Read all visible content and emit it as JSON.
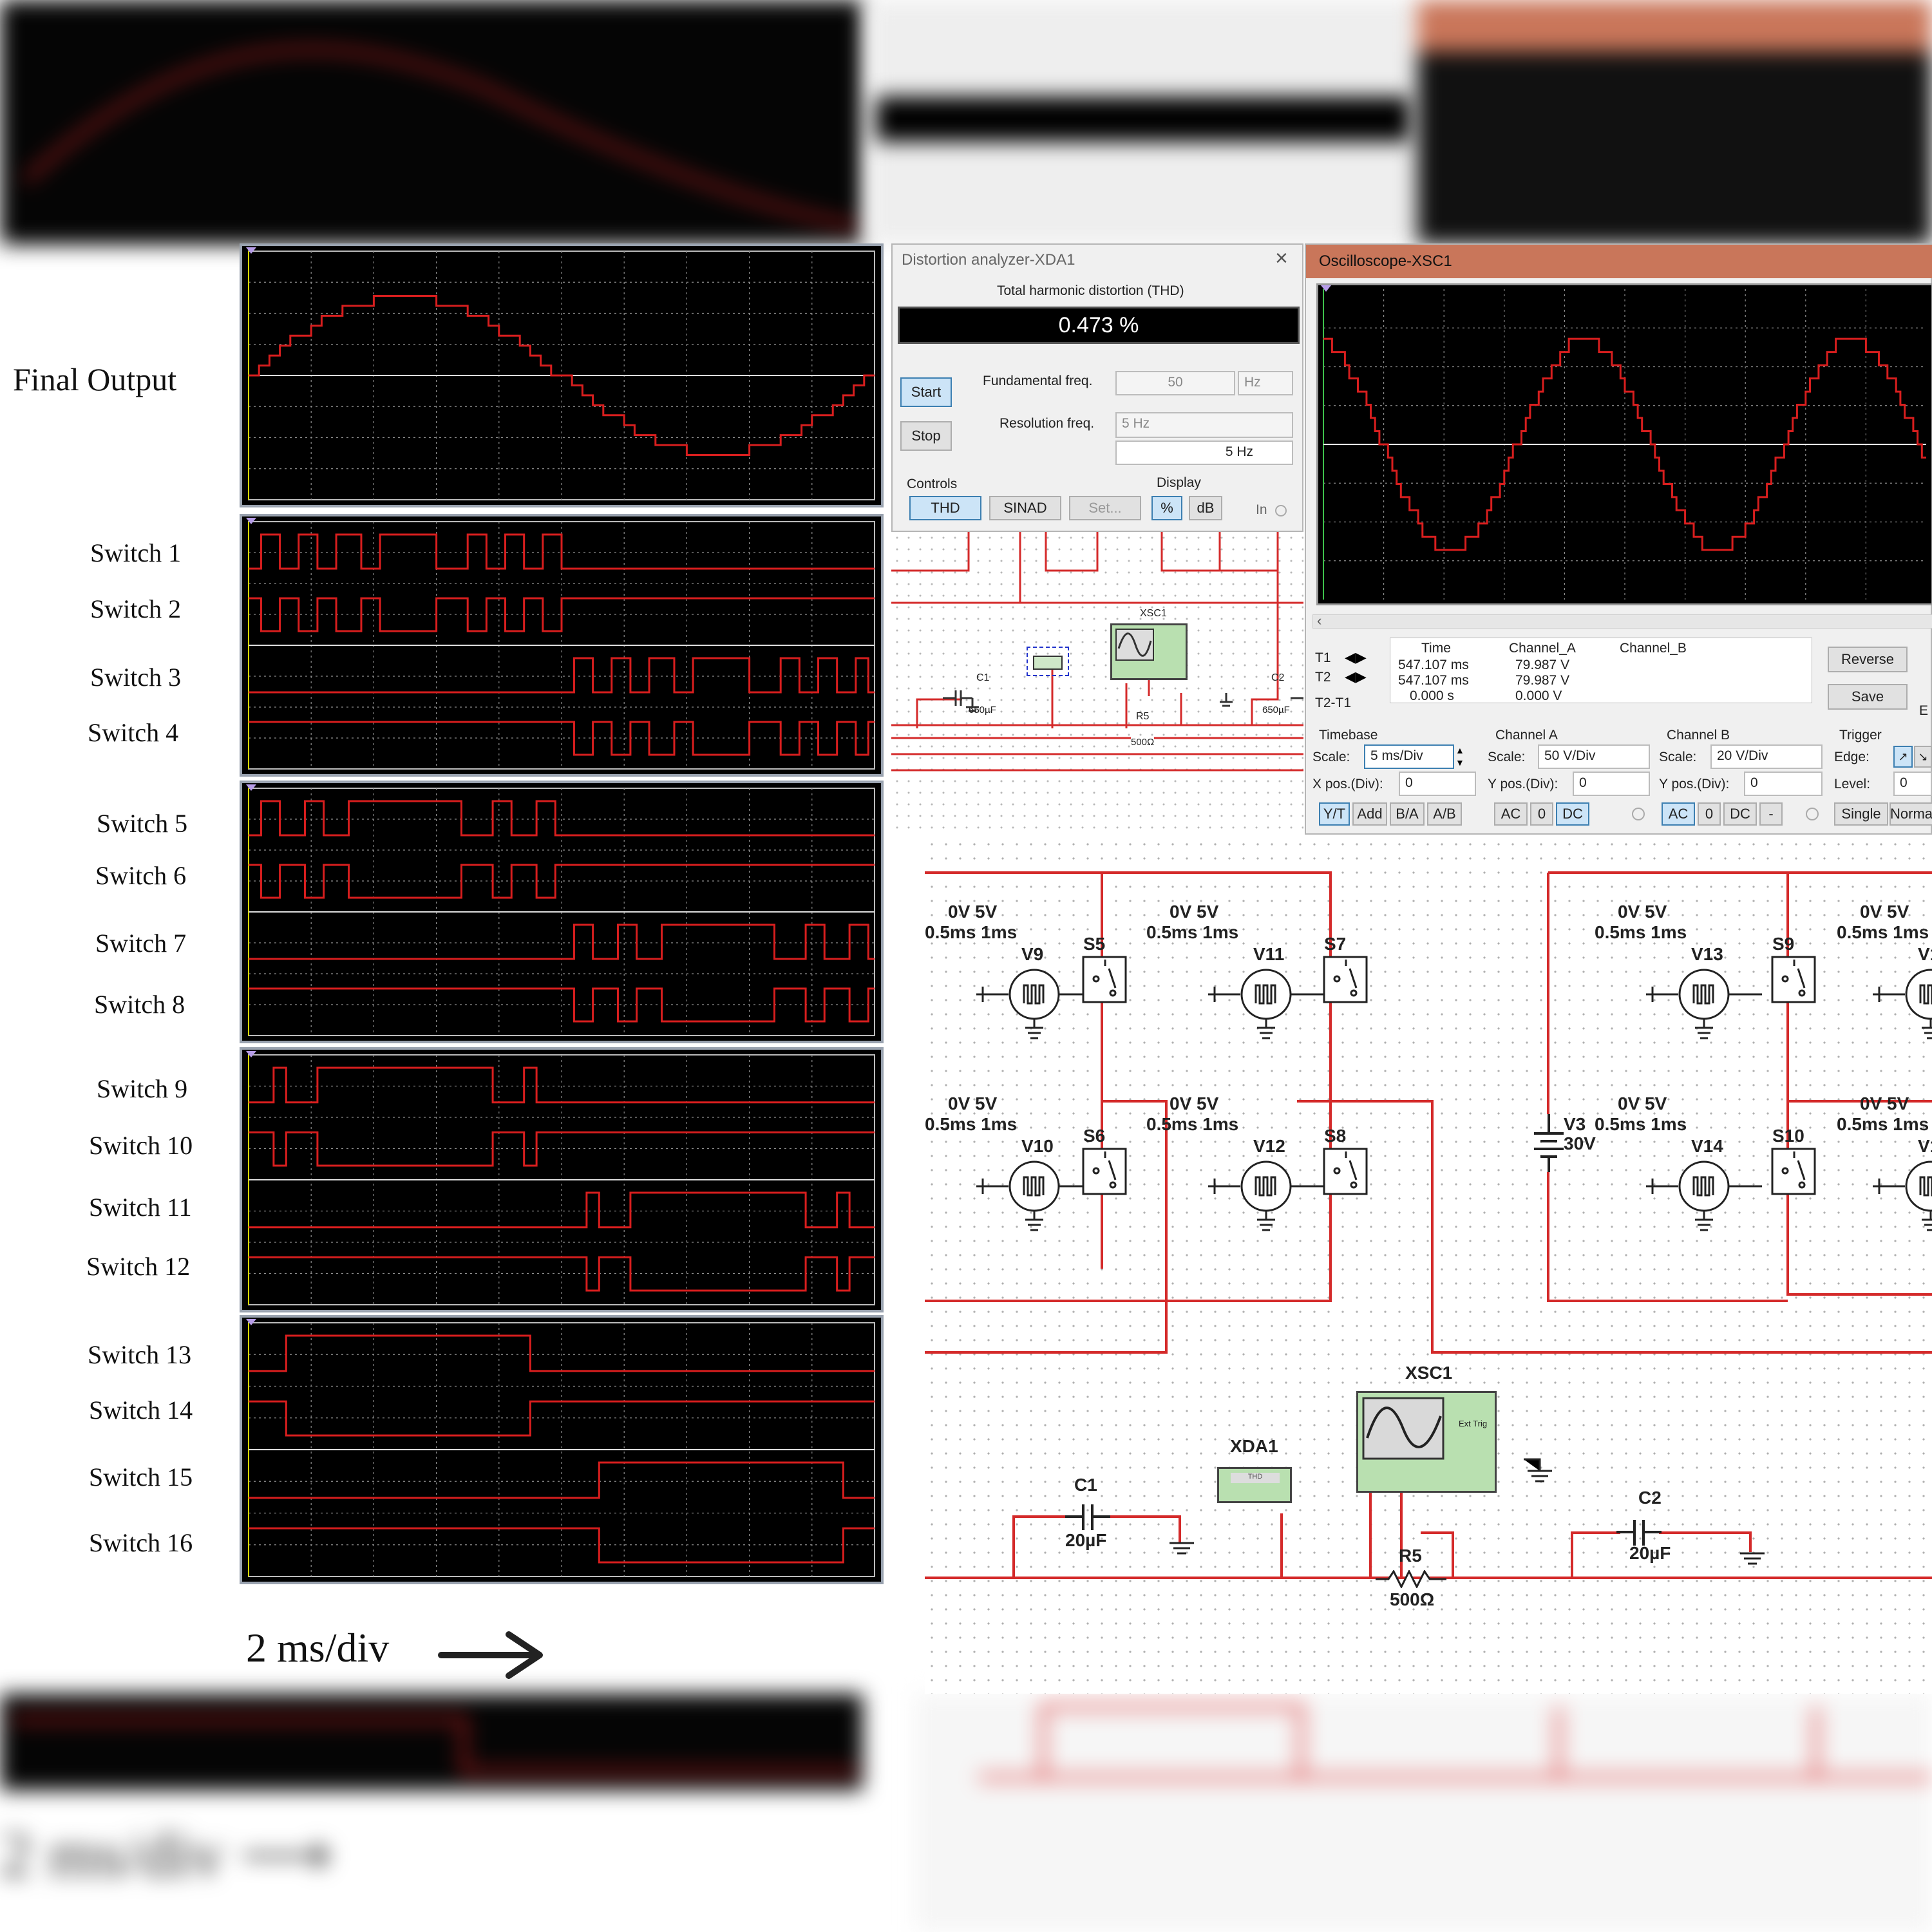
{
  "labels": {
    "final_output": "Final Output",
    "switches": [
      "Switch 1",
      "Switch 2",
      "Switch 3",
      "Switch 4",
      "Switch 5",
      "Switch 6",
      "Switch 7",
      "Switch 8",
      "Switch 9",
      "Switch 10",
      "Switch 11",
      "Switch 12",
      "Switch 13",
      "Switch 14",
      "Switch 15",
      "Switch 16"
    ],
    "timescale": "2 ms/div"
  },
  "distortion_analyzer": {
    "title": "Distortion analyzer-XDA1",
    "thd_label": "Total harmonic distortion (THD)",
    "thd_value": "0.473 %",
    "start": "Start",
    "stop": "Stop",
    "fund_label": "Fundamental freq.",
    "fund_value": "50",
    "fund_unit": "Hz",
    "res_label": "Resolution freq.",
    "res_value": "5 Hz",
    "res_value2": "5 Hz",
    "controls_label": "Controls",
    "display_label": "Display",
    "thd_btn": "THD",
    "sinad_btn": "SINAD",
    "set_btn": "Set...",
    "pct_btn": "%",
    "db_btn": "dB",
    "in_label": "In"
  },
  "oscilloscope": {
    "title": "Oscilloscope-XSC1",
    "title_color": "#c9765a",
    "t1": "T1",
    "t2": "T2",
    "t2t1": "T2-T1",
    "col_time": "Time",
    "col_a": "Channel_A",
    "col_b": "Channel_B",
    "t1_time": "547.107 ms",
    "t1_a": "79.987 V",
    "t2_time": "547.107 ms",
    "t2_a": "79.987 V",
    "d_time": "0.000 s",
    "d_a": "0.000 V",
    "reverse": "Reverse",
    "save": "Save",
    "ext": "E",
    "timebase": "Timebase",
    "scale": "Scale:",
    "tb_scale": "5 ms/Div",
    "xpos": "X pos.(Div):",
    "xpos_val": "0",
    "cha": "Channel A",
    "cha_scale": "50  V/Div",
    "ypos": "Y pos.(Div):",
    "ypos_a": "0",
    "chb": "Channel B",
    "chb_scale": "20  V/Div",
    "ypos_b": "0",
    "trigger": "Trigger",
    "edge": "Edge:",
    "level": "Level:",
    "level_val": "0",
    "yt": "Y/T",
    "add": "Add",
    "ba": "B/A",
    "ab": "A/B",
    "ac": "AC",
    "zero": "0",
    "dc": "DC",
    "minus": "-",
    "single": "Single",
    "normal": "Norma"
  },
  "circuit": {
    "src_params": "0V 5V",
    "src_times": "0.5ms 1ms",
    "sources": [
      "V9",
      "V11",
      "V10",
      "V12",
      "V13",
      "V1",
      "V14",
      "V1"
    ],
    "switches": [
      "S5",
      "S7",
      "S6",
      "S8",
      "S9",
      "S10"
    ],
    "v3": "V3",
    "v3_val": "30V",
    "xsc": "XSC1",
    "xda": "XDA1",
    "c1": "C1",
    "c1_val": "20µF",
    "c2": "C2",
    "c2_val": "20µF",
    "r5": "R5",
    "r5_val": "500Ω",
    "ext_trig": "Ext Trig",
    "thd": "THD",
    "small_c1_val": "650µF",
    "small_c2_val": "650µF",
    "small_r5_val": "500Ω"
  },
  "colors": {
    "trace": "#d81e1e",
    "grid": "#8c8c8c",
    "scope_bg": "#000000",
    "wire": "#d42a2a"
  }
}
